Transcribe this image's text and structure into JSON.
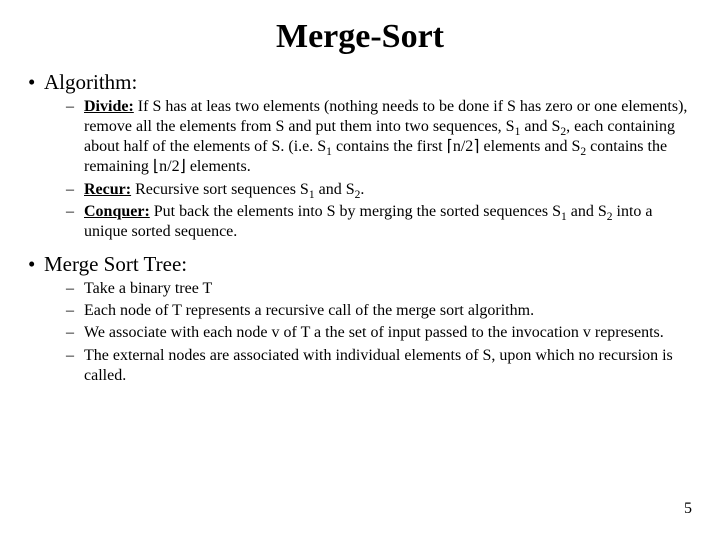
{
  "title": "Merge-Sort",
  "sections": [
    {
      "label": "Algorithm:",
      "items": [
        {
          "term": "Divide:",
          "body_parts": {
            "p0": " If S has at leas two elements (nothing needs to be done if S has zero or one elements), remove all the elements from S and put them into two sequences, S",
            "p1": " and S",
            "p2": ", each containing about half of the elements of S. (i.e. S",
            "p3": " contains the first ",
            "ceil_l": "⌈",
            "ceil_in": "n/2",
            "ceil_r": "⌉",
            "p4": " elements and S",
            "p5": " contains the remaining ",
            "floor_l": "⌊",
            "floor_in": "n/2",
            "floor_r": "⌋",
            "p6": " elements."
          },
          "subs": {
            "s1": "1",
            "s2": "2",
            "s3": "1",
            "s4": "2"
          }
        },
        {
          "term": "Recur:",
          "body_parts": {
            "p0": " Recursive sort sequences S",
            "p1": " and S",
            "p2": "."
          },
          "subs": {
            "s1": "1",
            "s2": "2"
          }
        },
        {
          "term": "Conquer:",
          "body_parts": {
            "p0": " Put back the elements into S by merging the sorted sequences S",
            "p1": " and S",
            "p2": " into a unique sorted sequence."
          },
          "subs": {
            "s1": "1",
            "s2": "2"
          }
        }
      ]
    },
    {
      "label": "Merge Sort Tree:",
      "items": [
        {
          "plain": "Take a binary tree T"
        },
        {
          "plain": "Each node of T represents a recursive call of the merge sort algorithm."
        },
        {
          "plain": "We associate with each node v of T a the set of input passed to the invocation v represents."
        },
        {
          "plain": "The external nodes are associated with individual elements of S, upon which no recursion is called."
        }
      ]
    }
  ],
  "page_number": "5"
}
